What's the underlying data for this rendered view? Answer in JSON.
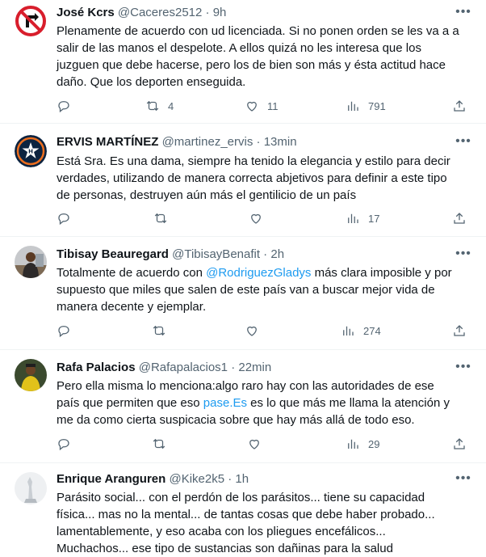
{
  "tweets": [
    {
      "name": "José Kcrs",
      "handle": "@Caceres2512",
      "sep": " · ",
      "time": "9h",
      "text": "Plenamente de acuerdo con ud licenciada. Si no ponen orden se les va a a salir de las manos el despelote. A ellos quizá no les interesa que los juzguen que debe hacerse, pero los de bien son más y ésta actitud hace daño. Que los deporten enseguida.",
      "replies": "",
      "retweets": "4",
      "likes": "11",
      "views": "791"
    },
    {
      "name": "ERVIS MARTÍNEZ",
      "handle": "@martinez_ervis",
      "sep": " · ",
      "time": "13min",
      "text": "Está Sra. Es una dama, siempre ha tenido la elegancia y estilo para decir verdades, utilizando de manera correcta  abjetivos para definir a este tipo de personas, destruyen aún más el gentilicio de un país",
      "replies": "",
      "retweets": "",
      "likes": "",
      "views": "17"
    },
    {
      "name": "Tibisay Beauregard",
      "handle": "@TibisayBenafit",
      "sep": " · ",
      "time": "2h",
      "text_before": "Totalmente de acuerdo con ",
      "mention": "@RodriguezGladys",
      "text_after": " más clara imposible y por supuesto que miles que salen de este país van a buscar mejor vida de manera decente y ejemplar.",
      "replies": "",
      "retweets": "",
      "likes": "",
      "views": "274"
    },
    {
      "name": "Rafa Palacios",
      "handle": "@Rafapalacios1",
      "sep": " · ",
      "time": "22min",
      "text_before": "Pero ella misma lo menciona:algo raro hay con las autoridades de ese país que permiten que eso ",
      "mention": "pase.Es",
      "text_after": " es lo que más me llama la atención y me da como cierta suspicacia sobre que hay más allá de todo eso.",
      "replies": "",
      "retweets": "",
      "likes": "",
      "views": "29"
    },
    {
      "name": "Enrique Aranguren",
      "handle": "@Kike2k5",
      "sep": " · ",
      "time": "1h",
      "text": "Parásito social... con el perdón de los parásitos... tiene su capacidad física... mas no la mental... de tantas cosas que debe haber probado... lamentablemente, y eso acaba con los pliegues encefálicos... Muchachos... ese tipo de sustancias son dañinas para la salud"
    }
  ],
  "icons": {
    "reply": "reply-icon",
    "retweet": "retweet-icon",
    "like": "heart-icon",
    "views": "views-icon",
    "share": "share-icon",
    "more": "more-icon"
  },
  "colors": {
    "link": "#1d9bf0",
    "secondary": "#536471",
    "text": "#0f1419",
    "divider": "#eff3f4"
  }
}
